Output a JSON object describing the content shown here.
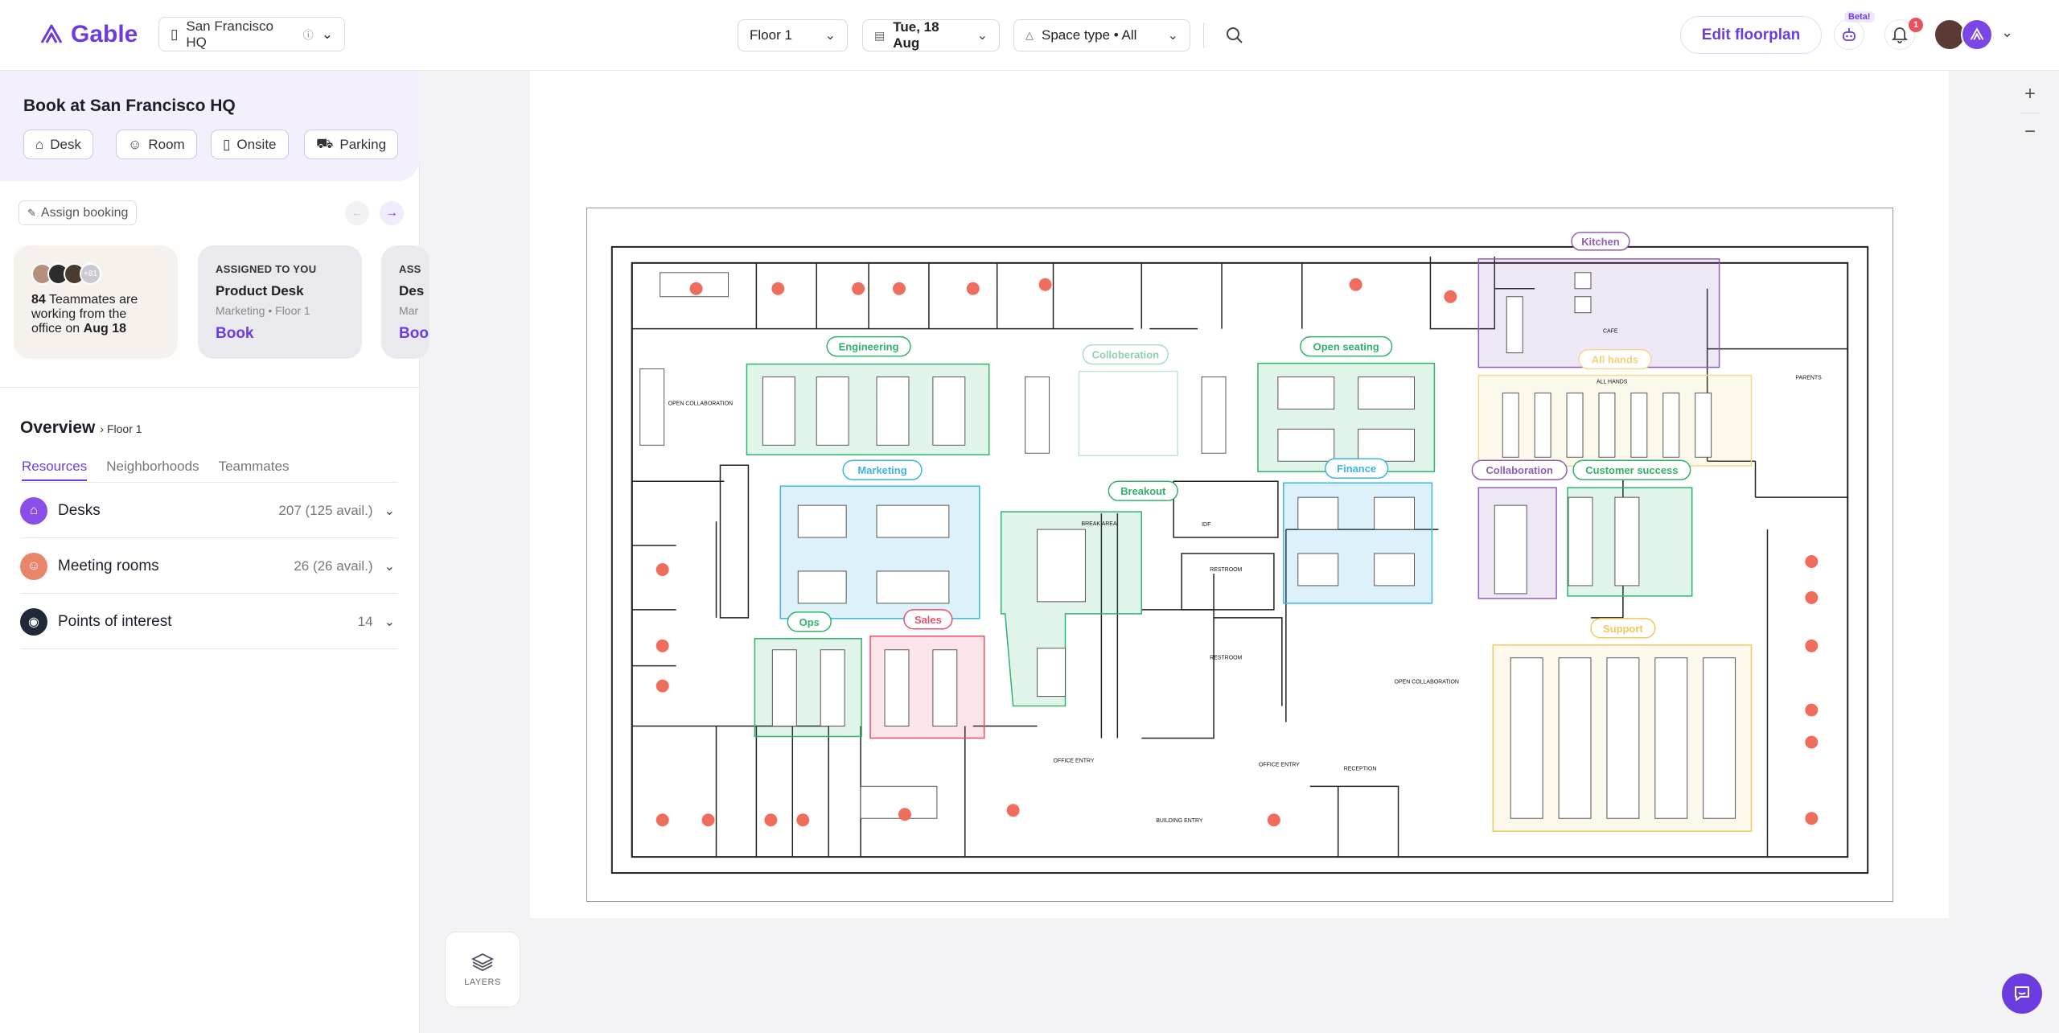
{
  "app": {
    "name": "Gable"
  },
  "header": {
    "location": "San Francisco HQ",
    "floor": "Floor 1",
    "date": "Tue, 18 Aug",
    "space_type": "Space type • All",
    "edit_label": "Edit floorplan",
    "beta_label": "Beta!",
    "notification_count": "1"
  },
  "book": {
    "title": "Book at San Francisco HQ",
    "options": [
      "Desk",
      "Room",
      "Onsite",
      "Parking"
    ]
  },
  "assign_label": "Assign booking",
  "cards": {
    "teammates_count": "84",
    "teammates_text": "Teammates are working from the office on",
    "teammates_date": "Aug 18",
    "more_avatars": "+81",
    "assigned_label": "ASSIGNED TO YOU",
    "desk_name": "Product Desk",
    "desk_sub": "Marketing • Floor 1",
    "book_label": "Book",
    "third_label": "ASS",
    "third_name": "Des",
    "third_sub": "Mar",
    "third_book": "Boo"
  },
  "overview": {
    "title": "Overview",
    "floor": "Floor 1",
    "tabs": [
      "Resources",
      "Neighborhoods",
      "Teammates"
    ],
    "resources": [
      {
        "name": "Desks",
        "count": "207 (125 avail.)",
        "icon": "desk-icon",
        "color": "#8b4ee8"
      },
      {
        "name": "Meeting rooms",
        "count": "26 (26 avail.)",
        "icon": "room-icon",
        "color": "#e8856b"
      },
      {
        "name": "Points of interest",
        "count": "14",
        "icon": "poi-icon",
        "color": "#1f2a36"
      }
    ]
  },
  "layers_label": "LAYERS",
  "zoom": {
    "in": "+",
    "out": "−"
  },
  "zones": {
    "kitchen": "Kitchen",
    "engineering": "Engineering",
    "collaboration_top": "Colloberation",
    "open_seating": "Open seating",
    "all_hands": "All hands",
    "marketing": "Marketing",
    "finance": "Finance",
    "collaboration": "Collaboration",
    "customer_success": "Customer success",
    "breakout": "Breakout",
    "ops": "Ops",
    "sales": "Sales",
    "support": "Support"
  },
  "plan_labels": {
    "open_collab": "OPEN COLLABORATION",
    "break_area": "BREAK AREA",
    "restroom": "RESTROOM",
    "idf": "IDF",
    "office_entry": "OFFICE ENTRY",
    "building_entry": "BUILDING ENTRY",
    "reception": "RECEPTION",
    "all_hands_room": "ALL HANDS",
    "parents": "PARENTS",
    "cafe": "CAFE",
    "open_collab_center": "OPEN COLLABORATION"
  },
  "colors": {
    "brand": "#6c3ce0",
    "green": "#2fb36b",
    "blue": "#3bb4e6",
    "purple": "#8d5fb8",
    "yellow": "#f2c760",
    "red": "#e8506b",
    "booking_dot": "#ef6d5c"
  }
}
